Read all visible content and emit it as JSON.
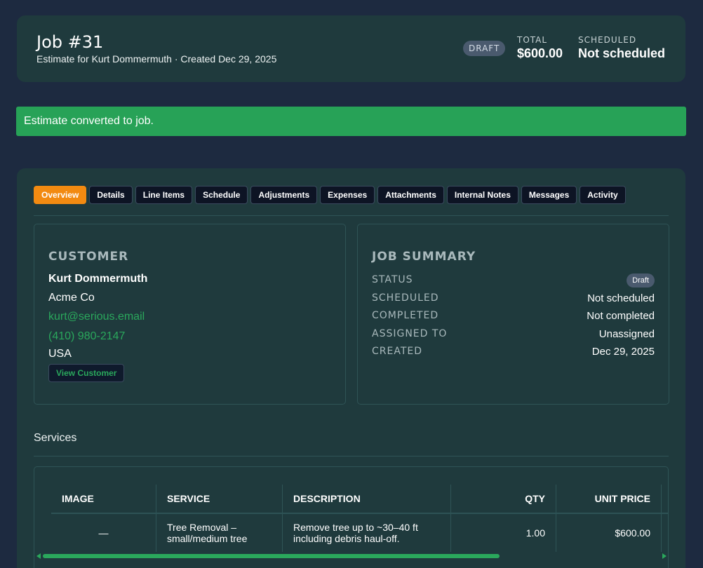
{
  "header": {
    "title": "Job #31",
    "subtitle": "Estimate for Kurt Dommermuth · Created Dec 29, 2025",
    "status_pill": "DRAFT",
    "total_label": "TOTAL",
    "total_value": "$600.00",
    "scheduled_label": "SCHEDULED",
    "scheduled_value": "Not scheduled"
  },
  "alert": {
    "message": "Estimate converted to job."
  },
  "tabs": [
    {
      "label": "Overview",
      "active": true
    },
    {
      "label": "Details"
    },
    {
      "label": "Line Items"
    },
    {
      "label": "Schedule"
    },
    {
      "label": "Adjustments"
    },
    {
      "label": "Expenses"
    },
    {
      "label": "Attachments"
    },
    {
      "label": "Internal Notes"
    },
    {
      "label": "Messages"
    },
    {
      "label": "Activity"
    }
  ],
  "customer": {
    "heading": "CUSTOMER",
    "name": "Kurt Dommermuth",
    "company": "Acme Co",
    "email": "kurt@serious.email",
    "phone": "(410) 980-2147",
    "country": "USA",
    "view_button": "View Customer"
  },
  "summary": {
    "heading": "JOB SUMMARY",
    "status_label": "STATUS",
    "status_value": "Draft",
    "scheduled_label": "SCHEDULED",
    "scheduled_value": "Not scheduled",
    "completed_label": "COMPLETED",
    "completed_value": "Not completed",
    "assigned_label": "ASSIGNED TO",
    "assigned_value": "Unassigned",
    "created_label": "CREATED",
    "created_value": "Dec 29, 2025"
  },
  "services": {
    "title": "Services",
    "columns": [
      "IMAGE",
      "SERVICE",
      "DESCRIPTION",
      "QTY",
      "UNIT PRICE"
    ],
    "rows": [
      {
        "image": "—",
        "service_line1": "Tree Removal –",
        "service_line2": "small/medium tree",
        "description_line1": "Remove tree up to ~30–40 ft",
        "description_line2": "including debris haul-off.",
        "qty": "1.00",
        "unit_price": "$600.00"
      }
    ],
    "scroll_fraction": 0.74
  },
  "colors": {
    "background": "#1d2a40",
    "card": "#1f3a3d",
    "accent_orange": "#f28a11",
    "success_green": "#27a257",
    "link_green": "#2aa85c"
  }
}
